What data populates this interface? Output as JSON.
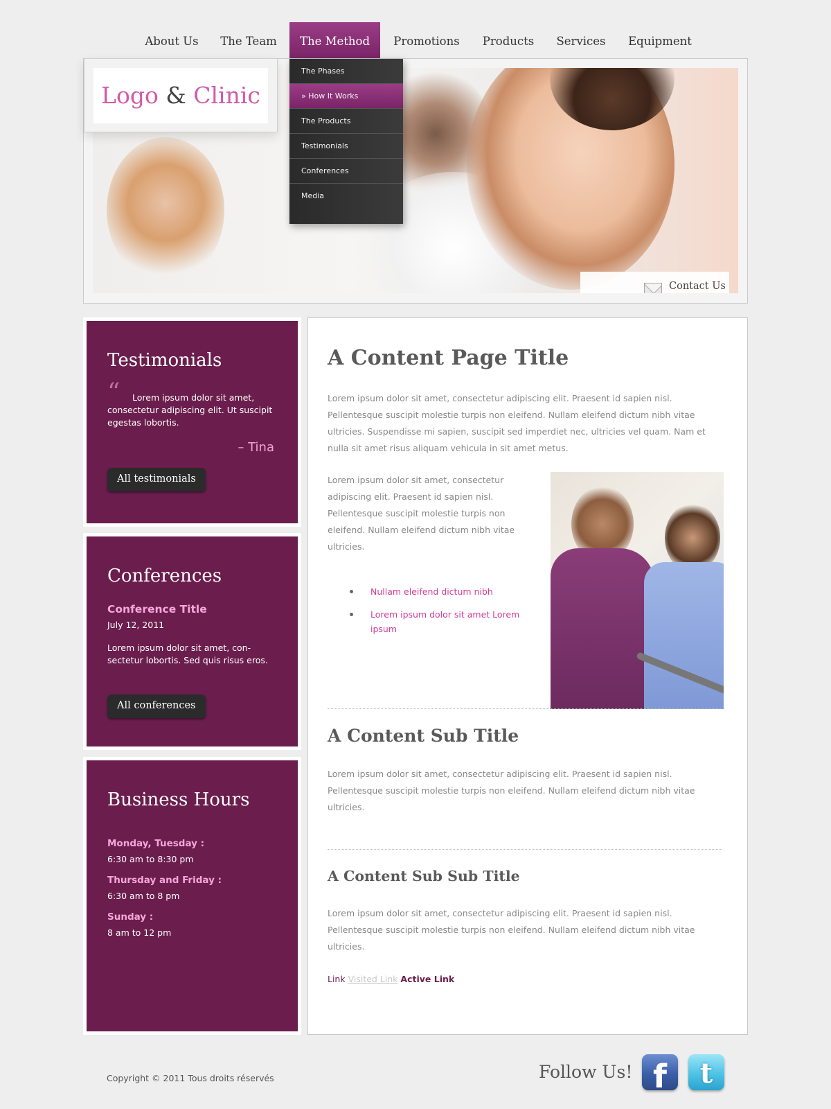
{
  "nav": {
    "items": [
      "About Us",
      "The Team",
      "The Method",
      "Promotions",
      "Products",
      "Services",
      "Equipment"
    ],
    "active": "The Method"
  },
  "dropdown": {
    "items": [
      "The Phases",
      "» How It Works",
      "The Products",
      "Testimonials",
      "Conferences",
      "Media"
    ],
    "active": "» How It Works"
  },
  "logo": {
    "part1": "Logo",
    "amp": "&",
    "part2": "Clinic"
  },
  "contact": {
    "label": "Contact Us",
    "icon": "mail-icon"
  },
  "testimonials": {
    "title": "Testimonials",
    "quote_icon": "quote-icon",
    "quote": "Lorem ipsum dolor sit amet, consectetur adipiscing elit. Ut suscipit egestas lobortis.",
    "author": "– Tina",
    "button": "All testimonials"
  },
  "conferences": {
    "title": "Conferences",
    "item_title": "Conference Title",
    "date": "July 12, 2011",
    "text": "Lorem ipsum dolor sit amet, con-sectetur lobortis. Sed quis risus eros.",
    "button": "All conferences"
  },
  "hours": {
    "title": "Business Hours",
    "rows": [
      {
        "day": "Monday, Tuesday :",
        "time": "6:30 am to 8:30 pm"
      },
      {
        "day": "Thursday and Friday :",
        "time": "6:30 am to 8 pm"
      },
      {
        "day": "Sunday :",
        "time": "8 am to 12 pm"
      }
    ]
  },
  "content": {
    "title": "A Content Page Title",
    "para1": "Lorem ipsum dolor sit amet, consectetur adipiscing elit. Praesent id sapien nisl. Pellentesque suscipit molestie turpis non eleifend. Nullam eleifend dictum nibh vitae ultricies. Suspendisse mi sapien, suscipit sed imperdiet nec, ultricies vel quam. Nam et nulla sit amet risus aliquam vehicula in sit amet metus.",
    "para2": "Lorem ipsum dolor sit amet, consectetur adipiscing elit. Praesent id sapien nisl. Pellentesque suscipit molestie turpis non eleifend. Nullam eleifend dictum nibh vitae ultricies.",
    "list": [
      "Nullam eleifend dictum nibh",
      "Lorem ipsum dolor sit amet Lorem ipsum"
    ],
    "sub_title": "A Content Sub Title",
    "para3": "Lorem ipsum dolor sit amet, consectetur adipiscing elit. Praesent id sapien nisl. Pellentesque suscipit molestie turpis non eleifend. Nullam eleifend dictum nibh vitae ultricies.",
    "sub_sub_title": "A Content Sub Sub Title",
    "para4": "Lorem ipsum dolor sit amet, consectetur adipiscing elit. Praesent id sapien nisl. Pellentesque suscipit molestie turpis non eleifend. Nullam eleifend dictum nibh vitae ultricies.",
    "links": {
      "link": "Link",
      "visited": "Visited Link",
      "active": "Active Link"
    }
  },
  "footer": {
    "copyright": "Copyright © 2011 Tous droits réservés",
    "follow": "Follow Us!",
    "facebook_letter": "f",
    "twitter_letter": "t"
  },
  "colors": {
    "brand_purple": "#6b1e4d",
    "nav_active": "#8b2d76",
    "pink_accent": "#d25aa8",
    "link_pink": "#d33b98"
  }
}
